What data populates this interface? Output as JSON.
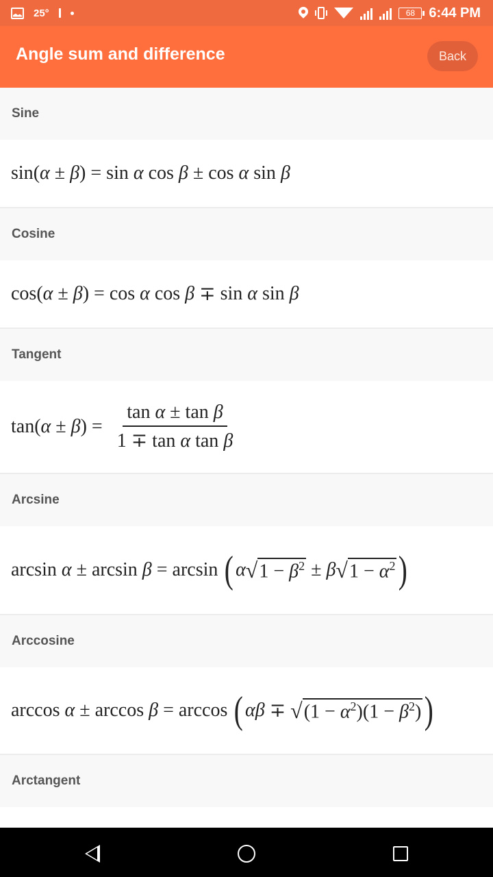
{
  "status_bar": {
    "temperature": "25°",
    "battery": "68",
    "time": "6:44 PM",
    "network_1": "3G",
    "network_2": "G",
    "icons": [
      "image-icon",
      "temperature",
      "signal-glyph",
      "dot",
      "location-icon",
      "vibrate-icon",
      "wifi-icon",
      "signal-3g-icon",
      "signal-g-icon",
      "battery-icon"
    ]
  },
  "app_bar": {
    "title": "Angle sum and difference",
    "back_label": "Back",
    "color": "#ff6e3d"
  },
  "sections": [
    {
      "title": "Sine",
      "formula": "sin(α ± β) = sin α cos β ± cos α sin β"
    },
    {
      "title": "Cosine",
      "formula": "cos(α ± β) = cos α cos β ∓ sin α sin β"
    },
    {
      "title": "Tangent",
      "formula": "tan(α ± β) = (tan α ± tan β) / (1 ∓ tan α tan β)"
    },
    {
      "title": "Arcsine",
      "formula": "arcsin α ± arcsin β = arcsin(α√(1 − β²) ± β√(1 − α²))"
    },
    {
      "title": "Arccosine",
      "formula": "arccos α ± arccos β = arccos(αβ ∓ √((1 − α²)(1 − β²)))"
    },
    {
      "title": "Arctangent",
      "formula": ""
    }
  ],
  "f": {
    "sin": "sin",
    "cos": "cos",
    "tan": "tan",
    "arcsin": "arcsin",
    "arccos": "arccos",
    "alpha": "α",
    "beta": "β",
    "pm": "±",
    "mp": "∓",
    "eq": "=",
    "lp": "(",
    "rp": ")",
    "one": "1",
    "minus": "−",
    "two": "2",
    "radical": "√"
  },
  "nav_bar": {
    "buttons": [
      "back",
      "home",
      "recents"
    ]
  }
}
